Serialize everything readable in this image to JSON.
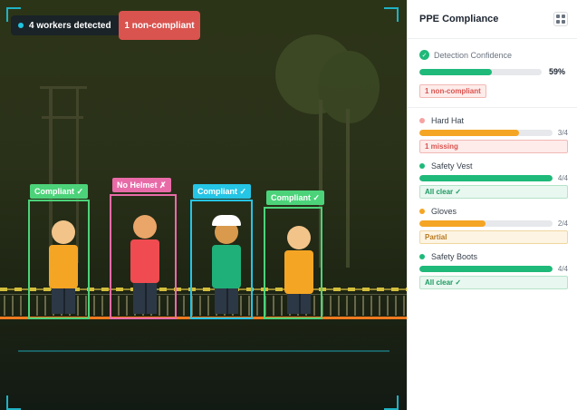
{
  "camera": {
    "workers_chip": "4 workers detected",
    "noncompliant_chip": "1 non-compliant",
    "accent_color": "#1fb2c4"
  },
  "workers": [
    {
      "label": "Compliant ✓",
      "box_color": "#4cd37a",
      "body_color": "#f5a524",
      "helmet": false
    },
    {
      "label": "No Helmet ✗",
      "box_color": "#e86ba8",
      "body_color": "#ef4b50",
      "helmet": false
    },
    {
      "label": "Compliant ✓",
      "box_color": "#25c5e6",
      "body_color": "#1fb07a",
      "helmet": true
    },
    {
      "label": "Compliant ✓",
      "box_color": "#4cd37a",
      "body_color": "#f5a524",
      "helmet": false
    }
  ],
  "sidebar": {
    "title": "PPE Compliance",
    "confidence": {
      "title": "Detection Confidence",
      "value": 0.59,
      "value_text": "59%",
      "color": "#1fb97a",
      "badge": "1 non-compliant"
    },
    "items": [
      {
        "name": "Hard Hat",
        "dot": "#f5a3a3",
        "bar_color": "#f5a524",
        "ratio": 0.75,
        "count": "3/4",
        "badge": "1 missing",
        "badge_kind": "red"
      },
      {
        "name": "Safety Vest",
        "dot": "#1fb97a",
        "bar_color": "#1fb97a",
        "ratio": 1.0,
        "count": "4/4",
        "badge": "All clear ✓",
        "badge_kind": "green"
      },
      {
        "name": "Gloves",
        "dot": "#f5a524",
        "bar_color": "#f5a524",
        "ratio": 0.5,
        "count": "2/4",
        "badge": "Partial",
        "badge_kind": "amber"
      },
      {
        "name": "Safety Boots",
        "dot": "#1fb97a",
        "bar_color": "#1fb97a",
        "ratio": 1.0,
        "count": "4/4",
        "badge": "All clear ✓",
        "badge_kind": "green"
      }
    ]
  }
}
